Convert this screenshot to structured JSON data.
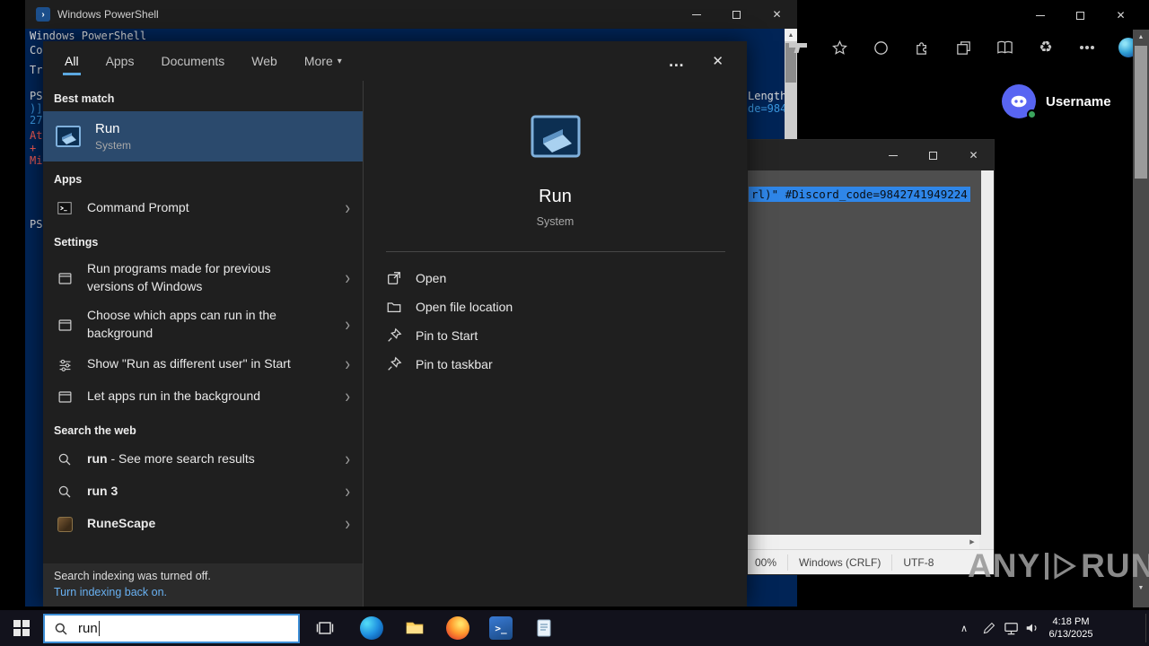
{
  "ps_window": {
    "title": "Windows PowerShell",
    "left_lines": [
      "Windows PowerShell",
      "Co",
      "Tr",
      "PS",
      ")]",
      "27",
      "At",
      "+",
      "Mi",
      "PS"
    ],
    "right_lines": [
      "Length",
      "de=984"
    ]
  },
  "search_panel": {
    "tabs": [
      "All",
      "Apps",
      "Documents",
      "Web",
      "More"
    ],
    "sections": {
      "best_match_header": "Best match",
      "best_match_title": "Run",
      "best_match_subtitle": "System",
      "apps_header": "Apps",
      "apps": [
        "Command Prompt"
      ],
      "settings_header": "Settings",
      "settings": [
        "Run programs made for previous versions of Windows",
        "Choose which apps can run in the background",
        "Show \"Run as different user\" in Start",
        "Let apps run in the background"
      ],
      "web_header": "Search the web",
      "web": [
        {
          "query": "run",
          "suffix": " - See more search results"
        },
        {
          "query": "run 3",
          "suffix": ""
        },
        {
          "query": "RuneScape",
          "suffix": ""
        }
      ],
      "footer_message": "Search indexing was turned off.",
      "footer_link": "Turn indexing back on."
    },
    "preview": {
      "title": "Run",
      "subtitle": "System",
      "actions": [
        "Open",
        "Open file location",
        "Pin to Start",
        "Pin to taskbar"
      ]
    }
  },
  "search_input": {
    "value": "run"
  },
  "notepad": {
    "selected_text": "rl)\" #Discord_code=9842741949224",
    "status": {
      "zoom": "00%",
      "line_ending": "Windows (CRLF)",
      "encoding": "UTF-8"
    }
  },
  "user_chip": {
    "name": "Username"
  },
  "clock": {
    "time": "4:18 PM",
    "date": "6/13/2025"
  },
  "watermark": {
    "any": "ANY",
    "run": "RUN"
  },
  "colors": {
    "accent": "#2f7fd4",
    "ps_background": "#012456",
    "selection": "#2f86e8",
    "link": "#69b1f2"
  },
  "icons": {
    "chevron": "›",
    "caret_down": "▾",
    "more": "…",
    "close": "✕",
    "arrow_up": "▲",
    "arrow_down": "▼",
    "arrow_right": "▶",
    "hidden_icons_caret": "∧",
    "recycle": "♻",
    "powershell_prompt": ">_"
  }
}
